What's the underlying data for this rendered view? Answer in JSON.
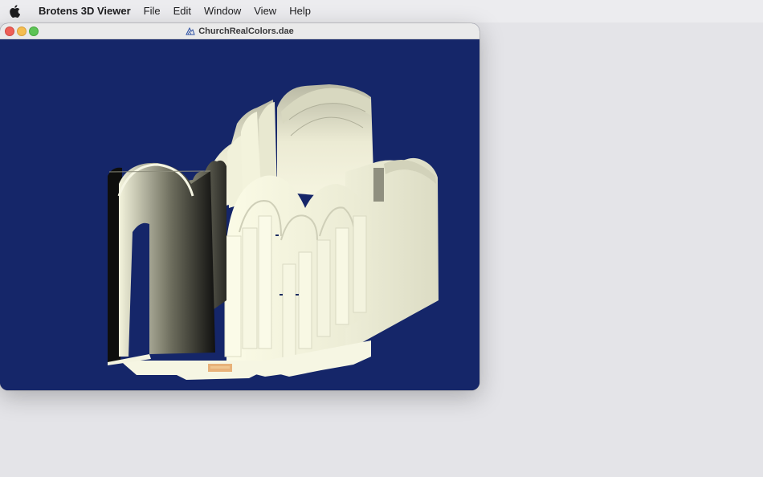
{
  "menubar": {
    "apple": "apple-icon",
    "app_name": "Brotens 3D Viewer",
    "items": [
      "File",
      "Edit",
      "Window",
      "View",
      "Help"
    ]
  },
  "window": {
    "title": "ChurchRealColors.dae",
    "viewport_background": "#152669",
    "model_color": "#f1f1dc"
  }
}
